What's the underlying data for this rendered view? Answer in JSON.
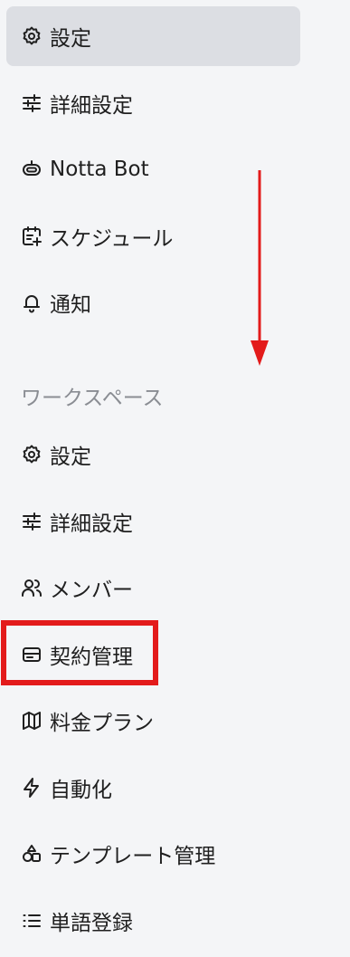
{
  "account": {
    "items": [
      {
        "label": "設定",
        "icon": "gear-icon"
      },
      {
        "label": "詳細設定",
        "icon": "sliders-icon"
      },
      {
        "label": "Notta Bot",
        "icon": "bot-icon"
      },
      {
        "label": "スケジュール",
        "icon": "calendar-clock-icon"
      },
      {
        "label": "通知",
        "icon": "bell-icon"
      }
    ]
  },
  "workspace": {
    "title": "ワークスペース",
    "items": [
      {
        "label": "設定",
        "icon": "gear-icon"
      },
      {
        "label": "詳細設定",
        "icon": "sliders-icon"
      },
      {
        "label": "メンバー",
        "icon": "users-icon"
      },
      {
        "label": "契約管理",
        "icon": "credit-card-icon"
      },
      {
        "label": "料金プラン",
        "icon": "map-icon"
      },
      {
        "label": "自動化",
        "icon": "lightning-icon"
      },
      {
        "label": "テンプレート管理",
        "icon": "template-icon"
      },
      {
        "label": "単語登録",
        "icon": "list-icon"
      }
    ]
  },
  "colors": {
    "active_bg": "#dcdee3",
    "highlight": "#e31b1b",
    "section_title": "#8a8d93"
  }
}
